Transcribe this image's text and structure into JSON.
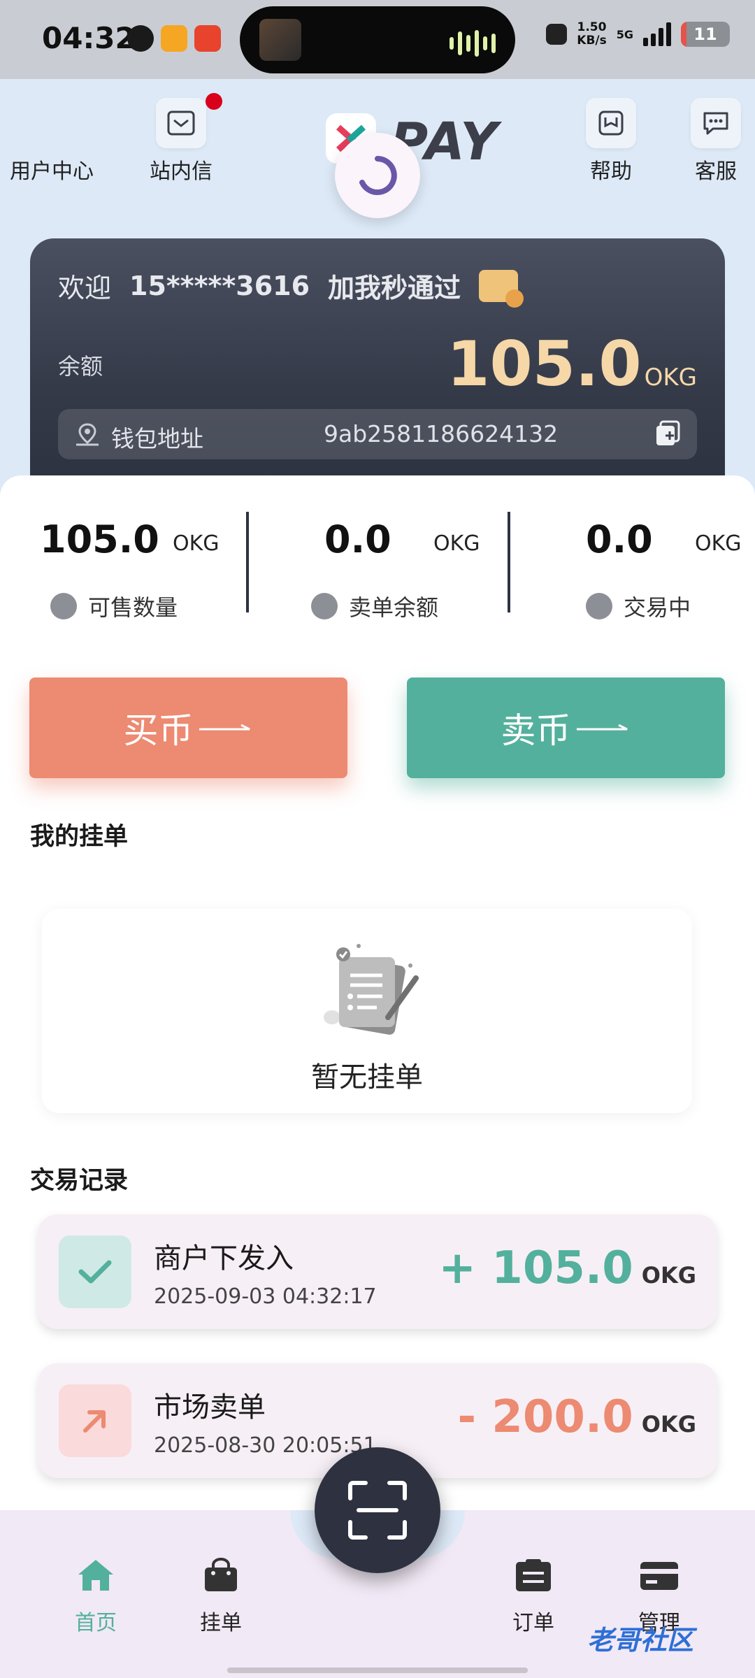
{
  "status_bar": {
    "time": "04:32",
    "speed_value": "1.50",
    "speed_unit": "KB/s",
    "network": "5G",
    "battery": "11",
    "battery_fraction": 0.11
  },
  "header": {
    "user_center": "用户中心",
    "inbox": "站内信",
    "logo_text": "PAY",
    "help": "帮助",
    "support": "客服"
  },
  "card": {
    "welcome": "欢迎",
    "phone": "15*****3616",
    "promo": "加我秒通过",
    "balance_label": "余额",
    "balance_value": "105.0",
    "balance_unit": "OKG",
    "address_label": "钱包地址",
    "address_value": "9ab2581186624132"
  },
  "stats": [
    {
      "value": "105.0",
      "unit": "OKG",
      "label": "可售数量"
    },
    {
      "value": "0.0",
      "unit": "OKG",
      "label": "卖单余额"
    },
    {
      "value": "0.0",
      "unit": "OKG",
      "label": "交易中"
    }
  ],
  "actions": {
    "buy_label": "买币",
    "sell_label": "卖币"
  },
  "my_orders": {
    "title": "我的挂单",
    "empty_text": "暂无挂单"
  },
  "records": {
    "title": "交易记录",
    "items": [
      {
        "title": "商户下发入",
        "time": "2025-09-03 04:32:17",
        "amount": "+ 105.0",
        "unit": "OKG",
        "color": "#53b09c"
      },
      {
        "title": "市场卖单",
        "time": "2025-08-30 20:05:51",
        "amount": "- 200.0",
        "unit": "OKG",
        "color": "#ec8a72"
      }
    ]
  },
  "nav": {
    "home": "首页",
    "orders_listed": "挂单",
    "orders": "订单",
    "manage": "管理"
  },
  "watermark": "老哥社区",
  "colors": {
    "accent_green": "#53b09c",
    "accent_orange": "#ec8a72",
    "card_dark": "#343a48",
    "balance_gold": "#f6d7a8"
  }
}
